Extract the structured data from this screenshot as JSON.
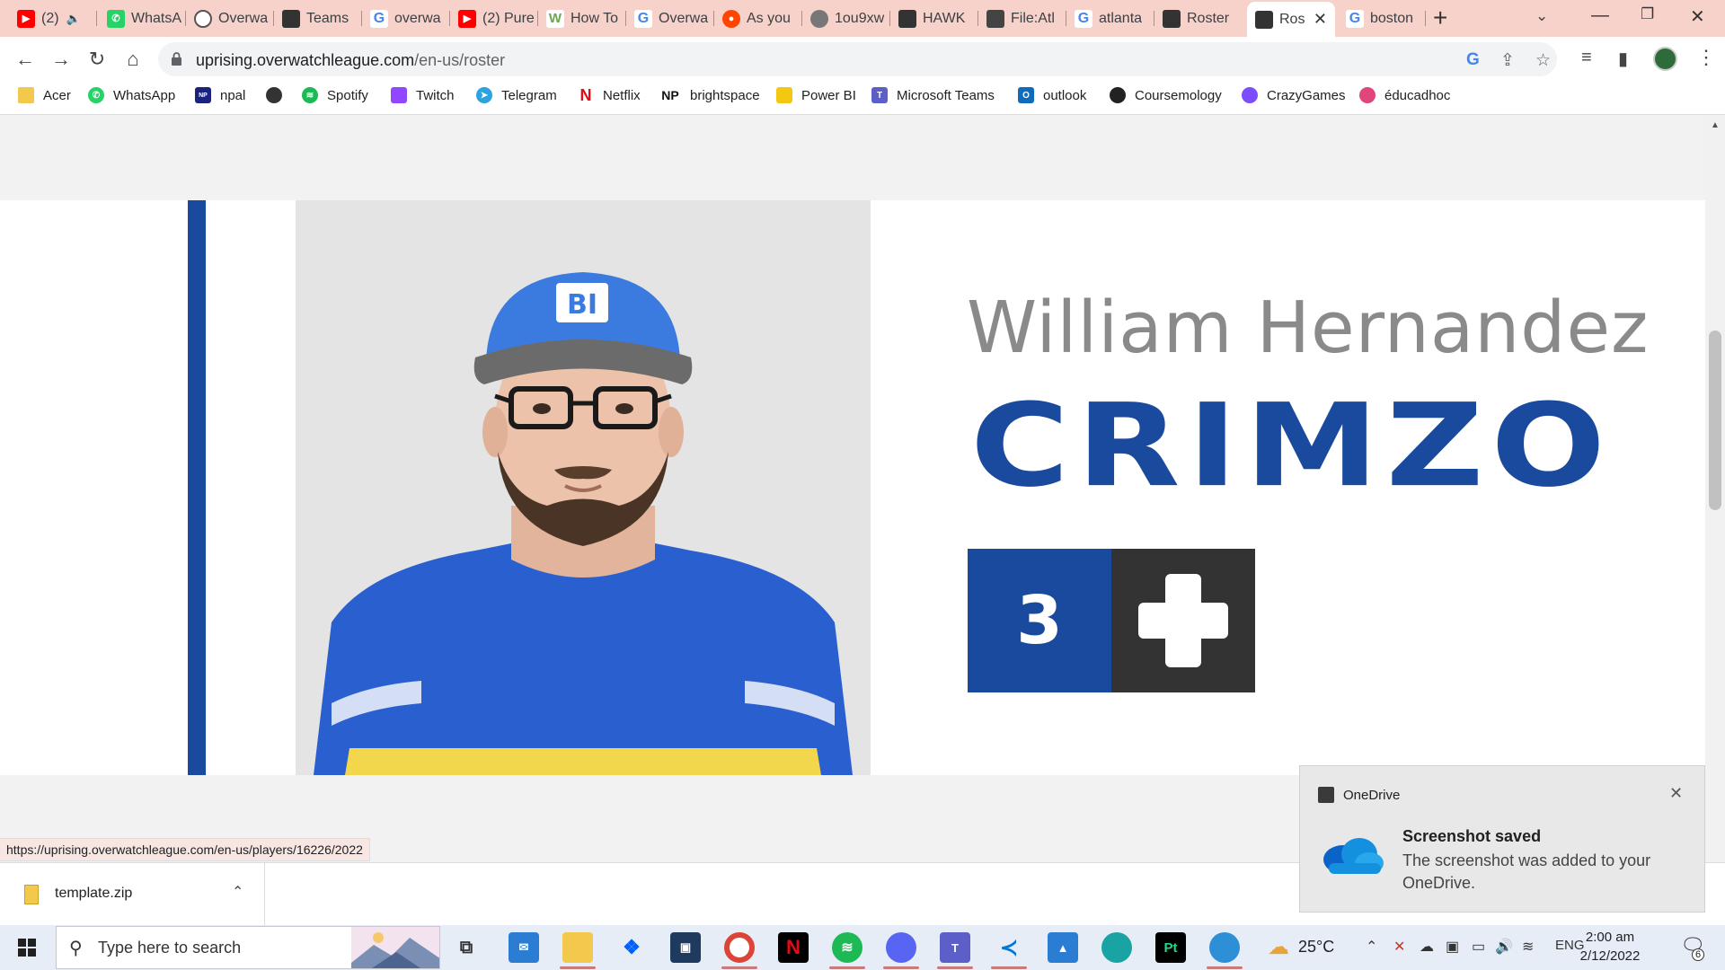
{
  "browser": {
    "tabs": [
      {
        "label": "(2)",
        "icon": "youtube-icon",
        "color": "#ff0000",
        "muted": true
      },
      {
        "label": "WhatsA",
        "icon": "whatsapp-icon",
        "color": "#25d366"
      },
      {
        "label": "Overwa",
        "icon": "overwatch-icon",
        "color": "#555555"
      },
      {
        "label": "Teams",
        "icon": "team-logo-icon",
        "color": "#333333"
      },
      {
        "label": "overwa",
        "icon": "google-icon",
        "color": "#4285f4"
      },
      {
        "label": "(2) Pure",
        "icon": "youtube-icon",
        "color": "#ff0000"
      },
      {
        "label": "How To",
        "icon": "wikihow-icon",
        "color": "#6aa84f"
      },
      {
        "label": "Overwa",
        "icon": "google-icon",
        "color": "#4285f4"
      },
      {
        "label": "As you",
        "icon": "reddit-icon",
        "color": "#ff4500"
      },
      {
        "label": "1ou9xw",
        "icon": "globe-icon",
        "color": "#777777"
      },
      {
        "label": "HAWK",
        "icon": "team-logo-icon",
        "color": "#333333"
      },
      {
        "label": "File:Atl",
        "icon": "wiki-icon",
        "color": "#444444"
      },
      {
        "label": "atlanta",
        "icon": "google-icon",
        "color": "#4285f4"
      },
      {
        "label": "Roster",
        "icon": "team-logo-icon",
        "color": "#333333"
      },
      {
        "label": "Ros",
        "icon": "team-logo-icon",
        "color": "#333333",
        "active": true
      },
      {
        "label": "boston",
        "icon": "google-icon",
        "color": "#4285f4"
      }
    ],
    "url_host": "uprising.overwatchleague.com",
    "url_path": "/en-us/roster",
    "bookmarks": [
      {
        "label": "Acer",
        "icon": "folder-icon",
        "color": "#f2c94c"
      },
      {
        "label": "WhatsApp",
        "icon": "whatsapp-icon",
        "color": "#25d366"
      },
      {
        "label": "npal",
        "icon": "npal-icon",
        "color": "#1a237e"
      },
      {
        "label": "",
        "icon": "globe-icon",
        "color": "#333333"
      },
      {
        "label": "Spotify",
        "icon": "spotify-icon",
        "color": "#1db954"
      },
      {
        "label": "Twitch",
        "icon": "twitch-icon",
        "color": "#9146ff"
      },
      {
        "label": "Telegram",
        "icon": "telegram-icon",
        "color": "#2aa3df"
      },
      {
        "label": "Netflix",
        "icon": "netflix-icon",
        "color": "#e50914"
      },
      {
        "label": "brightspace",
        "icon": "np-icon",
        "color": "#111111",
        "badge": "NP"
      },
      {
        "label": "Power BI",
        "icon": "powerbi-icon",
        "color": "#f2c811"
      },
      {
        "label": "Microsoft Teams",
        "icon": "teams-icon",
        "color": "#5b5fc7"
      },
      {
        "label": "outlook",
        "icon": "outlook-icon",
        "color": "#0f6cbd"
      },
      {
        "label": "Coursemology",
        "icon": "coursemology-icon",
        "color": "#222222"
      },
      {
        "label": "CrazyGames",
        "icon": "crazygames-icon",
        "color": "#7b4dff"
      },
      {
        "label": "éducadhoc",
        "icon": "educadhoc-icon",
        "color": "#e0457b"
      }
    ]
  },
  "player": {
    "name": "William Hernandez",
    "gamertag": "CRIMZO",
    "number": "3",
    "role_icon": "support-plus-icon"
  },
  "status_url": "https://uprising.overwatchleague.com/en-us/players/16226/2022",
  "download": {
    "filename": "template.zip"
  },
  "toast": {
    "app": "OneDrive",
    "title": "Screenshot saved",
    "body": "The screenshot was added to your OneDrive."
  },
  "taskbar": {
    "search_placeholder": "Type here to search",
    "apps": [
      "task-view-icon",
      "mail-icon",
      "file-explorer-icon",
      "dropbox-icon",
      "app-icon",
      "chrome-icon",
      "netflix-icon",
      "spotify-icon",
      "discord-icon",
      "teams-icon",
      "vscode-icon",
      "photos-icon",
      "edge-icon",
      "pycharm-icon",
      "edge-beta-icon"
    ],
    "temperature": "25°C",
    "language": "ENG",
    "time": "2:00 am",
    "date": "2/12/2022",
    "notification_count": "6"
  },
  "colors": {
    "team_blue": "#1a4a9e",
    "role_dark": "#333333",
    "tab_strip": "#f7d2cb"
  }
}
